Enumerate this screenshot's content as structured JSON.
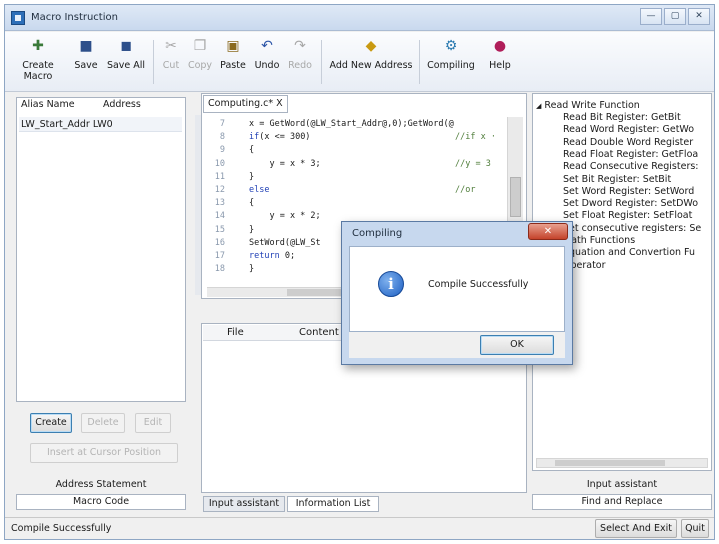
{
  "window": {
    "title": "Macro Instruction",
    "controls": [
      "—",
      "▢",
      "✕"
    ]
  },
  "toolbar": {
    "create_macro": "Create Macro",
    "save": "Save",
    "save_all": "Save All",
    "cut": "Cut",
    "copy": "Copy",
    "paste": "Paste",
    "undo": "Undo",
    "redo": "Redo",
    "add_new_address": "Add New Address",
    "compiling": "Compiling",
    "help": "Help"
  },
  "left_panel": {
    "headers": {
      "alias": "Alias Name",
      "address": "Address"
    },
    "rows": [
      {
        "alias": "LW_Start_Addr",
        "address": "LW0"
      }
    ],
    "buttons": {
      "create": "Create",
      "delete": "Delete",
      "edit": "Edit",
      "insert": "Insert at Cursor Position"
    },
    "address_statement": "Address Statement",
    "macro_code_tab": "Macro Code"
  },
  "editor": {
    "tab": "Computing.c* X",
    "lines": [
      {
        "num": "7",
        "code": "x = GetWord(@LW_Start_Addr@,0);GetWord(@"
      },
      {
        "num": "8",
        "code": "if(x <= 300)",
        "comment": "//if x ·"
      },
      {
        "num": "9",
        "code": "{"
      },
      {
        "num": "10",
        "code": "    y = x * 3;",
        "comment": "//y = 3"
      },
      {
        "num": "11",
        "code": "}"
      },
      {
        "num": "12",
        "code": "else",
        "comment": "//or"
      },
      {
        "num": "13",
        "code": "{"
      },
      {
        "num": "14",
        "code": "    y = x * 2;"
      },
      {
        "num": "15",
        "code": "}"
      },
      {
        "num": "16",
        "code": "SetWord(@LW_St"
      },
      {
        "num": "17",
        "code": "return 0;"
      },
      {
        "num": "18",
        "code": "}"
      }
    ]
  },
  "info_panel": {
    "columns": {
      "file": "File",
      "content": "Content"
    },
    "tabs": {
      "input_assistant": "Input assistant",
      "information_list": "Information List"
    }
  },
  "right_panel": {
    "tree": {
      "root": "Read Write Function",
      "items": [
        "Read Bit Register: GetBit",
        "Read Word Register: GetWo",
        "Read Double Word Register",
        "Read Float Register: GetFloa",
        "Read Consecutive Registers:",
        "Set Bit Register: SetBit",
        "Set Word Register: SetWord",
        "Set Dword Register: SetDWo",
        "Set Float Register: SetFloat",
        "Set consecutive registers: Se",
        "Math Functions",
        "Equation and Convertion Fu",
        "Operator"
      ]
    },
    "input_assistant": "Input assistant",
    "find_replace": "Find and Replace"
  },
  "dialog": {
    "title": "Compiling",
    "close": "✕",
    "message": "Compile Successfully",
    "ok": "OK"
  },
  "statusbar": {
    "text": "Compile Successfully",
    "select_and_exit": "Select And Exit",
    "quit": "Quit"
  }
}
